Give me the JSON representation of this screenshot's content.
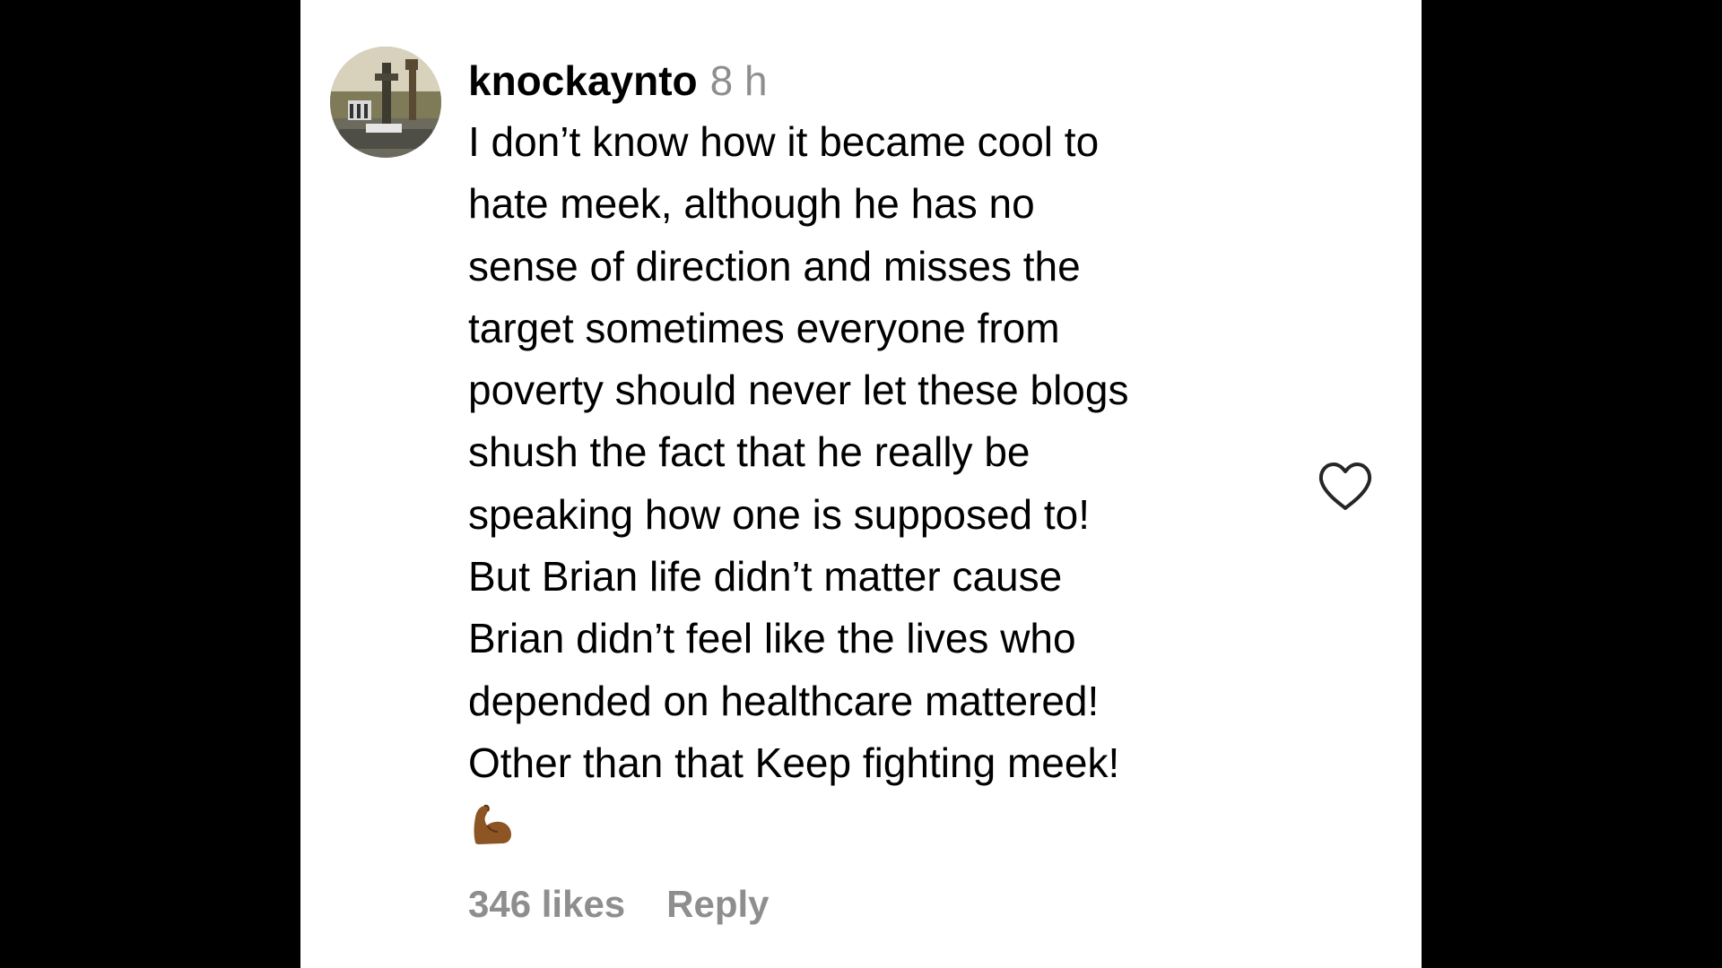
{
  "comment": {
    "username": "knockaynto",
    "time": "8 h",
    "lines": [
      "I don’t know how it became cool to",
      "hate meek, although he has no",
      "sense of direction and misses the",
      "target sometimes everyone from",
      "poverty should never let these blogs",
      "shush the fact that he really be",
      "speaking how one is supposed to!",
      "But Brian life didn’t matter cause",
      "Brian didn’t feel like the lives who",
      "depended on healthcare mattered!",
      "Other than that Keep fighting meek!"
    ],
    "emoji": "💪🏾",
    "likes": "346 likes",
    "reply": "Reply"
  },
  "icons": {
    "avatar": "profile-photo",
    "like": "heart-outline-icon",
    "emoji": "flexed-biceps"
  },
  "colors": {
    "background": "#000000",
    "panel": "#ffffff",
    "text": "#000000",
    "muted": "#8e8e8e",
    "skin": "#8d5524"
  }
}
